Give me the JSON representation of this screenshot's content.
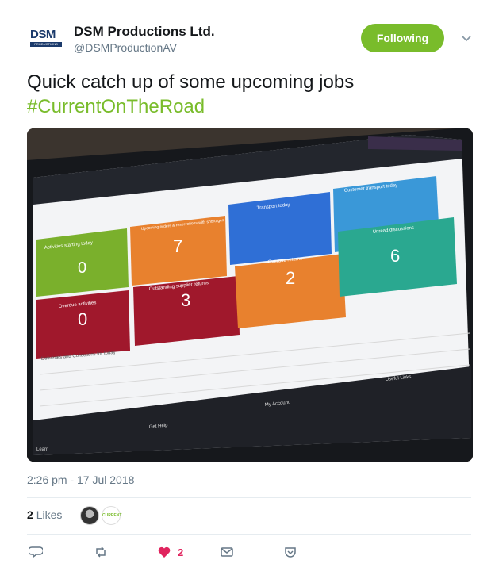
{
  "account": {
    "name": "DSM Productions Ltd.",
    "handle": "@DSMProductionAV",
    "logo_text": "DSM",
    "logo_sub": "PRODUCTIONS",
    "follow_label": "Following"
  },
  "tweet": {
    "text": "Quick catch up of some upcoming jobs",
    "hashtag": "#CurrentOnTheRoad",
    "timestamp": "2:26 pm - 17 Jul 2018",
    "likes_count": "2",
    "likes_label": "Likes",
    "like_action_count": "2"
  },
  "screen": {
    "tiles": [
      {
        "label": "Activities starting today",
        "value": "0",
        "color": "#7ab02c"
      },
      {
        "label": "Upcoming orders & reservations with shortages",
        "value": "7",
        "color": "#e8812e"
      },
      {
        "label": "Transport today",
        "value": "",
        "color": "#2f6fd6"
      },
      {
        "label": "Customer transport today",
        "value": "",
        "color": "#3a98d8"
      },
      {
        "label": "Overdue activities",
        "value": "0",
        "color": "#a0182c"
      },
      {
        "label": "Outstanding supplier returns",
        "value": "3",
        "color": "#a0182c"
      },
      {
        "label": "Overdue returns",
        "value": "2",
        "color": "#e8812e"
      },
      {
        "label": "Unread discussions",
        "value": "6",
        "color": "#2aa890"
      }
    ],
    "section_title": "Deliveries and Collections for today",
    "footer": {
      "learn": "Learn",
      "get_help": "Get Help",
      "my_account": "My Account",
      "useful_links": "Useful Links"
    }
  },
  "colors": {
    "brand_green": "#79bc2b",
    "like_red": "#e0245e",
    "secondary_text": "#657786"
  },
  "icons": [
    "chevron-down-icon",
    "reply-icon",
    "retweet-icon",
    "heart-icon",
    "message-icon",
    "share-icon"
  ]
}
